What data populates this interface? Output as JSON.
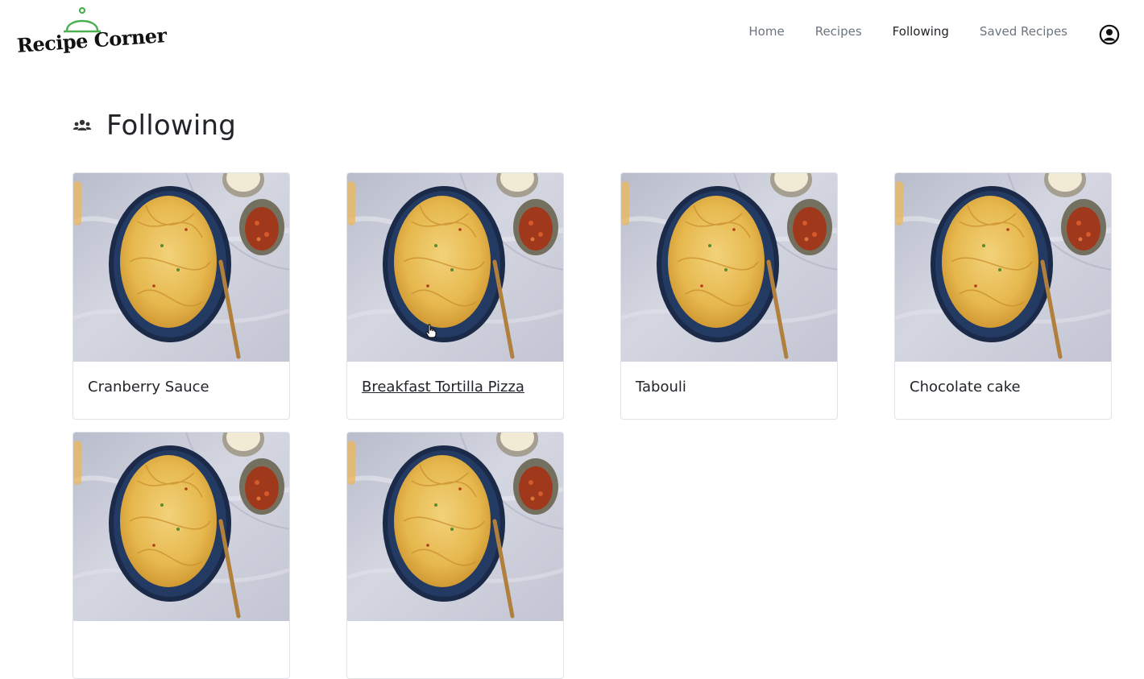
{
  "brand": {
    "name": "Recipe Corner",
    "accent_color": "#4caf50"
  },
  "nav": {
    "links": [
      {
        "label": "Home"
      },
      {
        "label": "Recipes"
      },
      {
        "label": "Following",
        "active": true
      },
      {
        "label": "Saved Recipes"
      }
    ],
    "profile_icon": "user-circle-icon"
  },
  "page": {
    "title": "Following",
    "icon": "users-icon"
  },
  "cards": [
    {
      "title": "Cranberry Sauce",
      "image": "spaghetti-plate"
    },
    {
      "title": "Breakfast Tortilla Pizza",
      "image": "spaghetti-plate",
      "hovered": true
    },
    {
      "title": "Tabouli",
      "image": "spaghetti-plate"
    },
    {
      "title": "Chocolate cake",
      "image": "spaghetti-plate"
    },
    {
      "title": "",
      "image": "spaghetti-plate"
    },
    {
      "title": "",
      "image": "spaghetti-plate"
    }
  ]
}
